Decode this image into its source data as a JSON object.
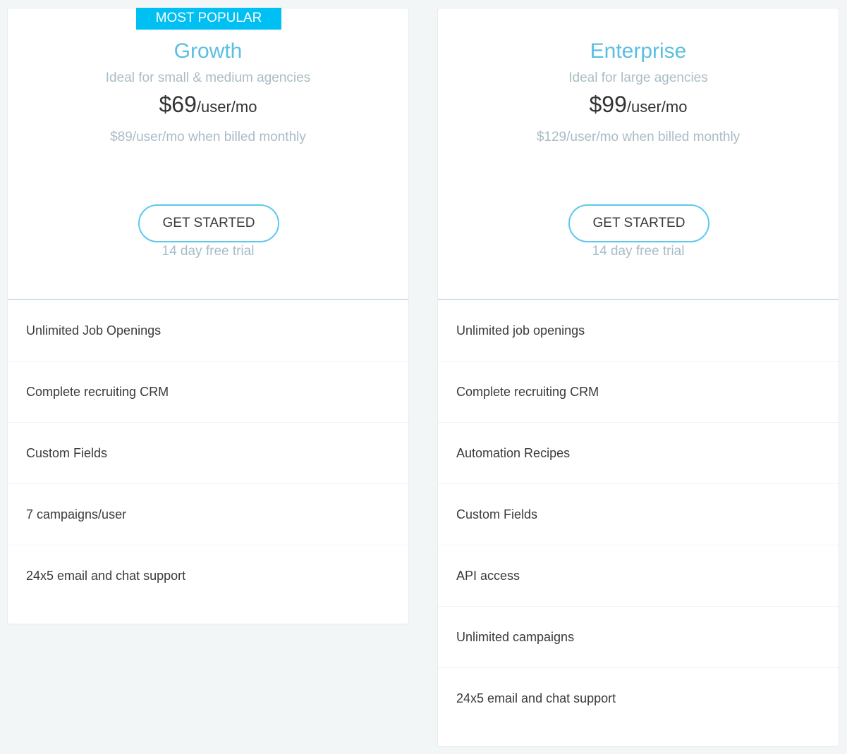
{
  "plans": [
    {
      "badge": "MOST POPULAR",
      "name": "Growth",
      "tagline": "Ideal for small & medium agencies",
      "price_amount": "$69",
      "price_unit": "/user/mo",
      "monthly_note": "$89/user/mo when billed monthly",
      "cta_label": "GET STARTED",
      "trial_note": "14 day free trial",
      "features": [
        "Unlimited Job Openings",
        "Complete recruiting CRM",
        "Custom Fields",
        "7 campaigns/user",
        "24x5 email and chat support"
      ]
    },
    {
      "name": "Enterprise",
      "tagline": "Ideal for large agencies",
      "price_amount": "$99",
      "price_unit": "/user/mo",
      "monthly_note": "$129/user/mo when billed monthly",
      "cta_label": "GET STARTED",
      "trial_note": "14 day free trial",
      "features": [
        "Unlimited job openings",
        "Complete recruiting CRM",
        "Automation Recipes",
        "Custom Fields",
        "API access",
        "Unlimited campaigns",
        "24x5 email and chat support"
      ]
    }
  ],
  "colors": {
    "badge": "#00bff3",
    "plan_name": "#5bbfe0",
    "muted_text": "#a9bcc6",
    "button_border": "#5cc8ee"
  }
}
